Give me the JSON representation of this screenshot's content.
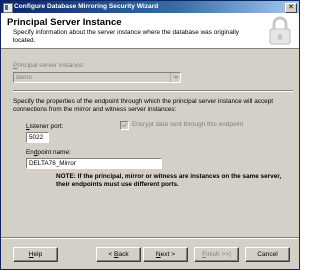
{
  "window": {
    "title": "Configure Database Mirroring Security Wizard",
    "close_glyph": "✕"
  },
  "header": {
    "title": "Principal Server Instance",
    "description": "Specify information about the server instance where the database was originally located."
  },
  "principal": {
    "label_prefix": "",
    "label_accel": "P",
    "label_rest": "rincipal server instance:",
    "value": "demo"
  },
  "endpoint_section": {
    "description": "Specify the properties of the endpoint through which the principal server instance will accept connections from the mirror and witness server instances:"
  },
  "listener": {
    "label_accel": "L",
    "label_rest": "istener port:",
    "value": "5022"
  },
  "encrypt": {
    "label": "Encrypt data sent through this endpoint",
    "checked": true
  },
  "endpoint": {
    "label_prefix": "En",
    "label_accel": "d",
    "label_rest": "point name:",
    "value": "DELTA76_Mirror"
  },
  "note": "NOTE: If the principal, mirror or witness are instances on the same server, their endpoints must use different ports.",
  "buttons": {
    "help": {
      "accel": "H",
      "rest": "elp"
    },
    "back": {
      "prefix": "< ",
      "accel": "B",
      "rest": "ack"
    },
    "next": {
      "accel": "N",
      "rest": "ext >"
    },
    "finish": {
      "accel": "F",
      "rest": "inish >>|"
    },
    "cancel": {
      "label": "Cancel"
    }
  }
}
